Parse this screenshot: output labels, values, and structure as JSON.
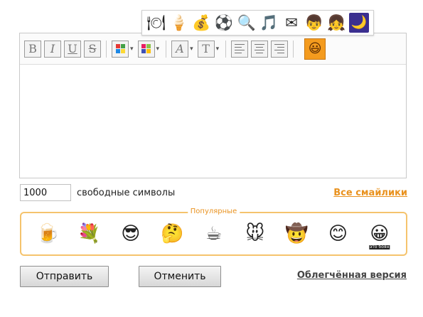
{
  "emoji_strip": {
    "items": [
      {
        "icon": "cutlery-icon",
        "glyph": "🍽"
      },
      {
        "icon": "ice-cream-icon",
        "glyph": "🍦"
      },
      {
        "icon": "dollar-icon",
        "glyph": "💰"
      },
      {
        "icon": "soccer-ball-icon",
        "glyph": "⚽"
      },
      {
        "icon": "magnifier-icon",
        "glyph": "🔍"
      },
      {
        "icon": "music-note-icon",
        "glyph": "🎵"
      },
      {
        "icon": "envelope-icon",
        "glyph": "✉"
      },
      {
        "icon": "boy-icon",
        "glyph": "👦"
      },
      {
        "icon": "girl-icon",
        "glyph": "👧"
      },
      {
        "icon": "moon-night-icon",
        "glyph": "🌙"
      }
    ]
  },
  "toolbar": {
    "bold": "B",
    "italic": "I",
    "underline": "U",
    "strike": "S",
    "font_face": "A",
    "font_size": "T",
    "dropdown_arrow": "▾",
    "text_color_swatches": [
      "#e53935",
      "#43a047",
      "#1e88e5",
      "#fdd835"
    ],
    "bg_color_swatches": [
      "#e91e63",
      "#8bc34a",
      "#3f51b5",
      "#ffc107"
    ],
    "smile_button_color": "#f49b1e",
    "smile_glyph": "😃"
  },
  "editor": {
    "text": ""
  },
  "counter": {
    "value": "1000",
    "label": "свободные символы"
  },
  "all_smiles_link": "Все смайлики",
  "popular": {
    "legend": "Популярные",
    "items": [
      {
        "icon": "smiley-with-beer-icon",
        "glyph": "🍺"
      },
      {
        "icon": "smiley-with-flowers-icon",
        "glyph": "💐"
      },
      {
        "icon": "smiley-with-tank-icon",
        "glyph": "😎"
      },
      {
        "icon": "smiley-thinking-icon",
        "glyph": "🤔"
      },
      {
        "icon": "smiley-with-cup-icon",
        "glyph": "☕"
      },
      {
        "icon": "mouse-icon",
        "glyph": "🐭"
      },
      {
        "icon": "cowboy-hat-icon",
        "glyph": "🤠"
      },
      {
        "icon": "smiley-with-stick-icon",
        "glyph": "😊"
      },
      {
        "icon": "smiley-sign-icon",
        "glyph": "😀",
        "caption": "это боян"
      }
    ]
  },
  "buttons": {
    "send": "Отправить",
    "cancel": "Отменить"
  },
  "lite_version_link": "Облегчённая версия",
  "colors": {
    "accent_orange": "#e9921f",
    "fieldset_border": "#f5c36d"
  }
}
